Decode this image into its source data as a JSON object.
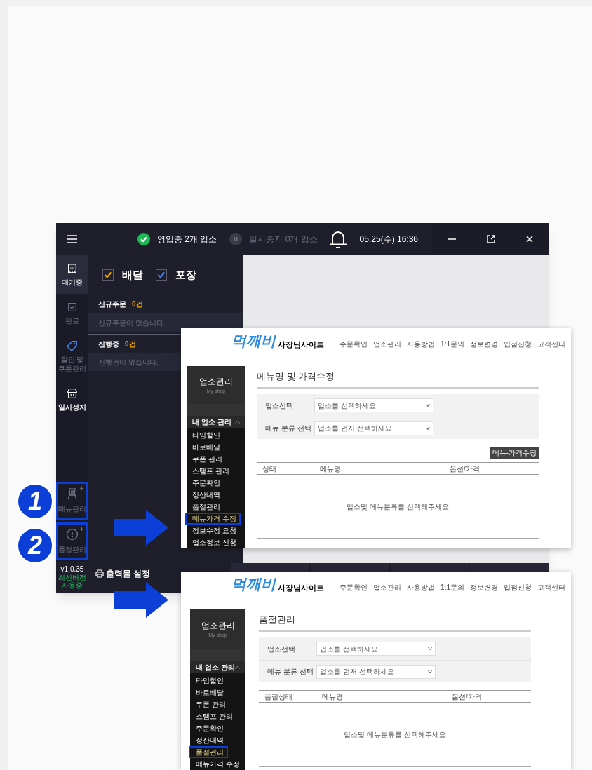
{
  "app": {
    "status": [
      {
        "kind": "open",
        "label": "영업중 2개 업소"
      },
      {
        "kind": "paused",
        "label": "일시중지 0개 업소"
      }
    ],
    "datetime": "05.25(수) 16:36",
    "rail_top": [
      {
        "kind": "receipt",
        "label": "대기중",
        "selected": true,
        "bold": false
      },
      {
        "kind": "done",
        "label": "완료",
        "selected": false,
        "bold": false
      },
      {
        "kind": "tag",
        "label": "할인 및 쿠폰관리",
        "selected": false,
        "bold": false
      },
      {
        "kind": "store",
        "label": "일시정지",
        "selected": false,
        "bold": true
      }
    ],
    "rail_bottom": [
      {
        "kind": "menu",
        "label": "메뉴관리",
        "highlighted": true
      },
      {
        "kind": "alert",
        "label": "품절관리",
        "highlighted": true
      }
    ],
    "filters": [
      {
        "label": "배달",
        "checked": true,
        "color": "#f0a500"
      },
      {
        "label": "포장",
        "checked": true,
        "color": "#3d8bff"
      }
    ],
    "sections": [
      {
        "title": "신규주문",
        "count": "0건",
        "empty": "신규주문이 없습니다."
      },
      {
        "title": "진행중",
        "count": "0건",
        "empty": "진행건이 없습니다."
      }
    ],
    "version": "v1.0.35",
    "version_note": "최신버전 사용중",
    "print_button": "출력물 설정"
  },
  "callouts": [
    "1",
    "2"
  ],
  "sites": [
    {
      "logo": "먹깨비",
      "logo_sub": "사장님사이트",
      "nav": [
        "주문확인",
        "업소관리",
        "사용방법",
        "1:1문의",
        "정보변경",
        "입점신청",
        "고객센터"
      ],
      "sidebar_title": "업소관리",
      "sidebar_subtitle": "My shop",
      "group": "내 업소 관리",
      "group_expanded": true,
      "menu": [
        {
          "label": "타임할인",
          "selected": false
        },
        {
          "label": "바로배달",
          "selected": false
        },
        {
          "label": "쿠폰 관리",
          "selected": false
        },
        {
          "label": "스탬프 관리",
          "selected": false
        },
        {
          "label": "주문확인",
          "selected": false
        },
        {
          "label": "정산내역",
          "selected": false
        },
        {
          "label": "품절관리",
          "selected": false
        },
        {
          "label": "메뉴가격 수정",
          "selected": true
        },
        {
          "label": "정보수정 요청",
          "selected": false
        },
        {
          "label": "업소정보 신청",
          "selected": false
        }
      ],
      "title": "메뉴명 및 가격수정",
      "filters": [
        {
          "label": "업소선택",
          "value": "업소를 선택하세요"
        },
        {
          "label": "메뉴 분류 선택",
          "value": "업소를 먼저 선택하세요"
        }
      ],
      "action_button": "메뉴-가격수정",
      "columns": [
        "상태",
        "메뉴명",
        "옵션/가격"
      ],
      "empty": "업소및 메뉴분류를 선택해주세요"
    },
    {
      "logo": "먹깨비",
      "logo_sub": "사장님사이트",
      "nav": [
        "주문확인",
        "업소관리",
        "사용방법",
        "1:1문의",
        "정보변경",
        "입점신청",
        "고객센터"
      ],
      "sidebar_title": "업소관리",
      "sidebar_subtitle": "My shop",
      "group": "내 업소 관리",
      "group_expanded": true,
      "menu": [
        {
          "label": "타임할인",
          "selected": false
        },
        {
          "label": "바로배달",
          "selected": false
        },
        {
          "label": "쿠폰 관리",
          "selected": false
        },
        {
          "label": "스탬프 관리",
          "selected": false
        },
        {
          "label": "주문확인",
          "selected": false
        },
        {
          "label": "정산내역",
          "selected": false
        },
        {
          "label": "품절관리",
          "selected": true
        },
        {
          "label": "메뉴가격 수정",
          "selected": false
        }
      ],
      "title": "품절관리",
      "filters": [
        {
          "label": "업소선택",
          "value": "업소를 선택하세요"
        },
        {
          "label": "메뉴 분류 선택",
          "value": "업소를 먼저 선택하세요"
        }
      ],
      "columns": [
        "품절상태",
        "메뉴명",
        "옵션/가격"
      ],
      "empty": "업소및 메뉴분류를 선택해주세요"
    }
  ]
}
